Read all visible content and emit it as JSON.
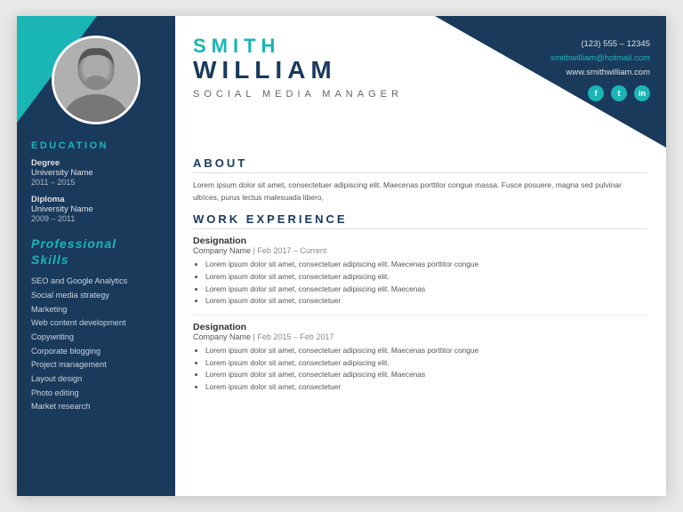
{
  "header": {
    "first_name": "SMITH",
    "last_name": "WILLIAM",
    "job_title": "Social Media Manager",
    "phone": "(123) 555 – 12345",
    "email": "smithwilliam@hotmail.com",
    "website": "www.smithwilliam.com"
  },
  "social": {
    "facebook_label": "f",
    "twitter_label": "t",
    "linkedin_label": "in"
  },
  "about": {
    "heading": "ABOUT",
    "text": "Lorem ipsum dolor sit amet, consectetuer adipiscing elit. Maecenas porttitor congue massa. Fusce posuere, magna sed pulvinar ultrices, purus lectus malesuada libero,"
  },
  "work_experience": {
    "heading": "WORK EXPERIENCE",
    "jobs": [
      {
        "designation": "Designation",
        "company": "Company Name",
        "period": "Feb 2017 – Current",
        "bullets": [
          "Lorem ipsum dolor sit amet, consectetuer adipiscing elit. Maecenas porttitor congue",
          "Lorem ipsum dolor sit amet, consectetuer adipiscing elit.",
          "Lorem ipsum dolor sit amet, consectetuer adipiscing elit. Maecenas",
          "Lorem ipsum dolor sit amet, consectetuer"
        ]
      },
      {
        "designation": "Designation",
        "company": "Company Name",
        "period": "Feb 2015 – Feb 2017",
        "bullets": [
          "Lorem ipsum dolor sit amet, consectetuer adipiscing elit. Maecenas porttitor congue",
          "Lorem ipsum dolor sit amet, consectetuer adipiscing elit.",
          "Lorem ipsum dolor sit amet, consectetuer adipiscing elit. Maecenas",
          "Lorem ipsum dolor sit amet, consectetuer"
        ]
      }
    ]
  },
  "education": {
    "heading": "EDUCATION",
    "items": [
      {
        "label": "Degree",
        "school": "University Name",
        "years": "2011 – 2015"
      },
      {
        "label": "Diploma",
        "school": "University Name",
        "years": "2009 – 2011"
      }
    ]
  },
  "skills": {
    "heading": "Professional\nSkills",
    "items": [
      "SEO and Google Analytics",
      "Social media strategy",
      "Marketing",
      "Web content development",
      "Copywriting",
      "Corporate blogging",
      "Project management",
      "Layout design",
      "Photo editing",
      "Market research"
    ]
  }
}
